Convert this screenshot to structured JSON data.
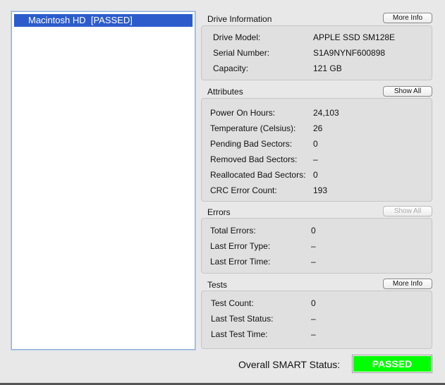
{
  "drive_list": [
    {
      "label": "Macintosh HD  [PASSED]"
    }
  ],
  "drive_info": {
    "title": "Drive Information",
    "button": "More Info",
    "rows": [
      [
        "Drive Model:",
        "APPLE SSD SM128E"
      ],
      [
        "Serial Number:",
        "S1A9NYNF600898"
      ],
      [
        "Capacity:",
        "121 GB"
      ]
    ]
  },
  "attributes": {
    "title": "Attributes",
    "button": "Show All",
    "rows": [
      [
        "Power On Hours:",
        "24,103"
      ],
      [
        "Temperature (Celsius):",
        "26"
      ],
      [
        "Pending Bad Sectors:",
        "0"
      ],
      [
        "Removed Bad Sectors:",
        "–"
      ],
      [
        "Reallocated Bad Sectors:",
        "0"
      ],
      [
        "CRC Error Count:",
        "193"
      ]
    ]
  },
  "errors": {
    "title": "Errors",
    "button": "Show All",
    "rows": [
      [
        "Total Errors:",
        "0"
      ],
      [
        "Last Error Type:",
        "–"
      ],
      [
        "Last Error Time:",
        "–"
      ]
    ]
  },
  "tests": {
    "title": "Tests",
    "button": "More Info",
    "rows": [
      [
        "Test Count:",
        "0"
      ],
      [
        "Last Test Status:",
        "–"
      ],
      [
        "Last Test Time:",
        "–"
      ]
    ]
  },
  "overall": {
    "label": "Overall SMART Status:",
    "value": "PASSED",
    "color": "#00ff00"
  }
}
